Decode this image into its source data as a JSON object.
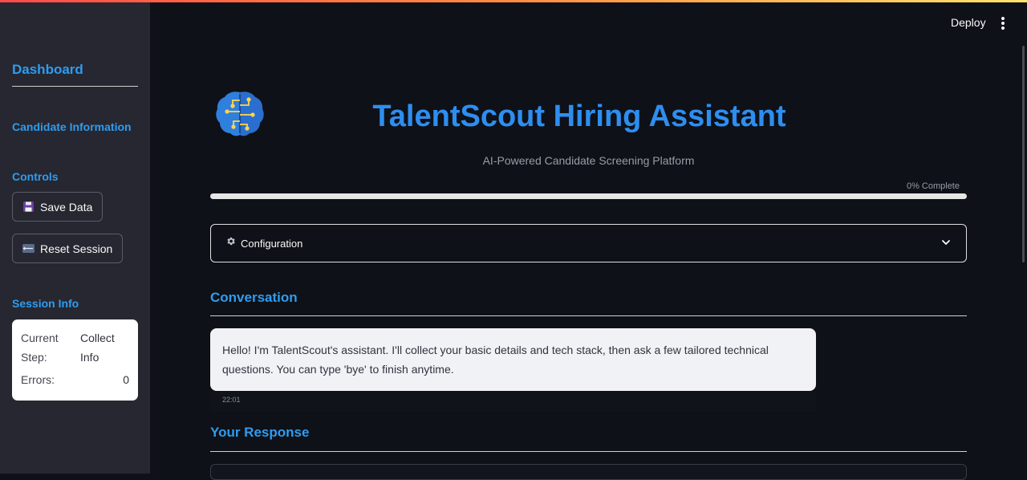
{
  "sidebar": {
    "title": "Dashboard",
    "candidate_section": "Candidate Information",
    "controls_section": "Controls",
    "save_button": "Save Data",
    "reset_button": "Reset Session",
    "session_section": "Session Info",
    "session": {
      "current_step_key": "Current Step:",
      "current_step_value": "Collect Info",
      "errors_key": "Errors:",
      "errors_value": "0"
    }
  },
  "header": {
    "deploy_label": "Deploy",
    "menu_icon": "kebab-menu-icon"
  },
  "main": {
    "logo_icon": "brain-circuit-icon",
    "title": "TalentScout Hiring Assistant",
    "subtitle": "AI-Powered Candidate Screening Platform",
    "progress": {
      "label": "0% Complete",
      "value": 0
    },
    "config": {
      "label": "Configuration",
      "icon": "gear-icon",
      "expand_icon": "chevron-down-icon"
    },
    "conversation": {
      "heading": "Conversation",
      "messages": [
        {
          "text": "Hello! I'm TalentScout's assistant. I'll collect your basic details and tech stack, then ask a few tailored technical questions. You can type 'bye' to finish anytime.",
          "time": "22:01"
        }
      ]
    },
    "response_heading": "Your Response"
  },
  "colors": {
    "accent": "#2e8ef0",
    "background": "#0e1117",
    "sidebar": "#262730",
    "bubble": "#f0f2f6"
  }
}
